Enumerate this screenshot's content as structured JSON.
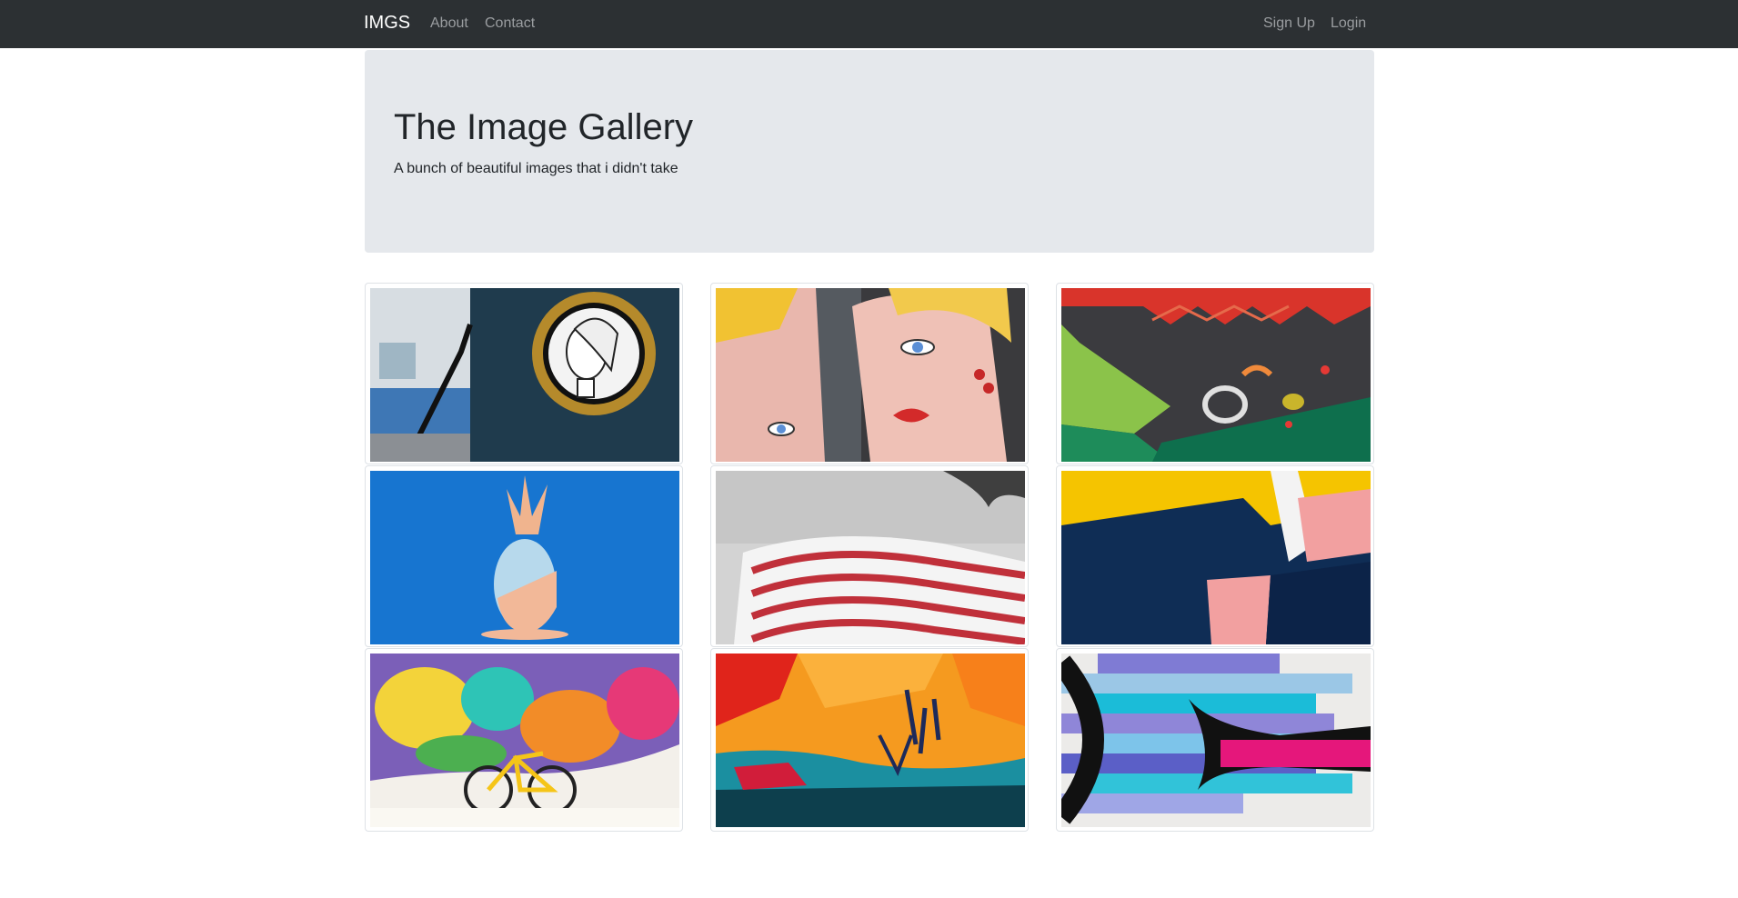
{
  "navbar": {
    "brand": "IMGS",
    "links": [
      "About",
      "Contact"
    ],
    "auth": {
      "signup": "Sign Up",
      "login": "Login"
    },
    "background": "#2c3033"
  },
  "jumbotron": {
    "title": "The Image Gallery",
    "subtitle": "A bunch of beautiful images that i didn't take",
    "background": "#e5e8ec"
  },
  "gallery": {
    "images": [
      "street-art-woman-portrait",
      "pop-art-faces",
      "abstract-graffiti-red-green",
      "blue-pineapple-on-blue",
      "red-white-striped-building",
      "yellow-navy-pink-geometric-wall",
      "colorful-mural-yellow-bike",
      "orange-abstract-paint",
      "blue-purple-arrow-graffiti"
    ]
  }
}
